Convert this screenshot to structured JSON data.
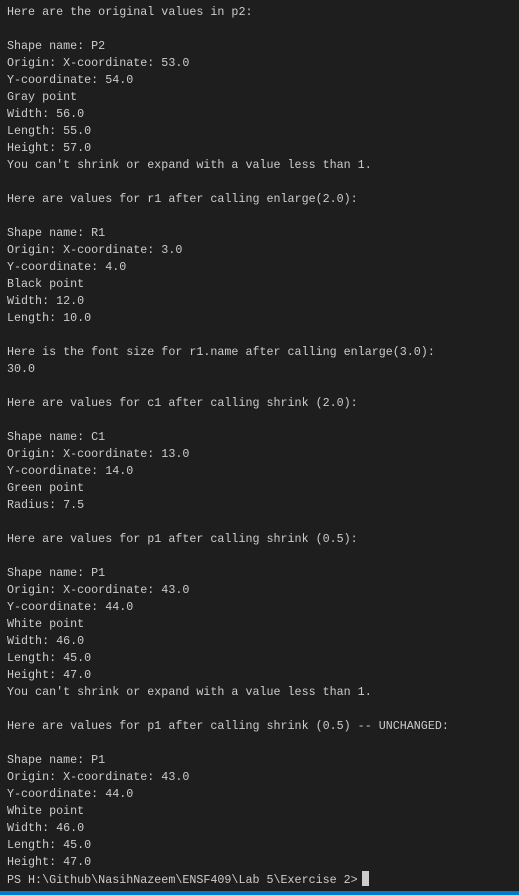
{
  "terminal": {
    "lines": [
      "Here are the original values in p2:",
      "",
      "Shape name: P2",
      "Origin: X-coordinate: 53.0",
      "Y-coordinate: 54.0",
      "Gray point",
      "Width: 56.0",
      "Length: 55.0",
      "Height: 57.0",
      "You can't shrink or expand with a value less than 1.",
      "",
      "Here are values for r1 after calling enlarge(2.0):",
      "",
      "Shape name: R1",
      "Origin: X-coordinate: 3.0",
      "Y-coordinate: 4.0",
      "Black point",
      "Width: 12.0",
      "Length: 10.0",
      "",
      "Here is the font size for r1.name after calling enlarge(3.0):",
      "30.0",
      "",
      "Here are values for c1 after calling shrink (2.0):",
      "",
      "Shape name: C1",
      "Origin: X-coordinate: 13.0",
      "Y-coordinate: 14.0",
      "Green point",
      "Radius: 7.5",
      "",
      "Here are values for p1 after calling shrink (0.5):",
      "",
      "Shape name: P1",
      "Origin: X-coordinate: 43.0",
      "Y-coordinate: 44.0",
      "White point",
      "Width: 46.0",
      "Length: 45.0",
      "Height: 47.0",
      "You can't shrink or expand with a value less than 1.",
      "",
      "Here are values for p1 after calling shrink (0.5) -- UNCHANGED:",
      "",
      "Shape name: P1",
      "Origin: X-coordinate: 43.0",
      "Y-coordinate: 44.0",
      "White point",
      "Width: 46.0",
      "Length: 45.0",
      "Height: 47.0"
    ],
    "prompt": "PS H:\\Github\\NasihNazeem\\ENSF409\\Lab 5\\Exercise 2>"
  },
  "colors": {
    "background": "#1e1e1e",
    "text": "#cccccc",
    "accent": "#007acc"
  }
}
